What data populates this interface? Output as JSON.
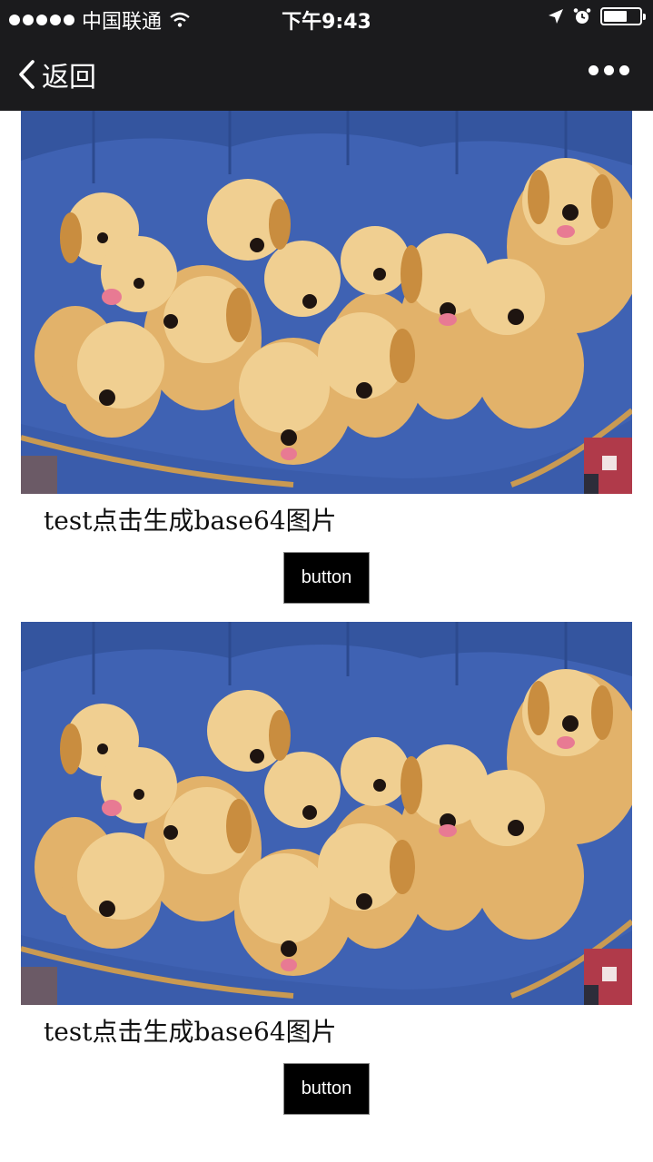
{
  "status_bar": {
    "carrier": "中国联通",
    "time": "下午9:43",
    "icons": [
      "signal-dots-icon",
      "wifi-icon",
      "location-arrow-icon",
      "alarm-icon",
      "battery-icon"
    ]
  },
  "nav": {
    "back_label": "返回",
    "back_icon": "chevron-left-icon",
    "more_icon": "more-dots-icon"
  },
  "items": [
    {
      "caption": "test点击生成base64图片",
      "button_label": "button"
    },
    {
      "caption": "test点击生成base64图片",
      "button_label": "button"
    }
  ],
  "colors": {
    "bar_background": "#1b1b1d",
    "button_background": "#000000",
    "cushion_blue": "#3d5fb0"
  }
}
